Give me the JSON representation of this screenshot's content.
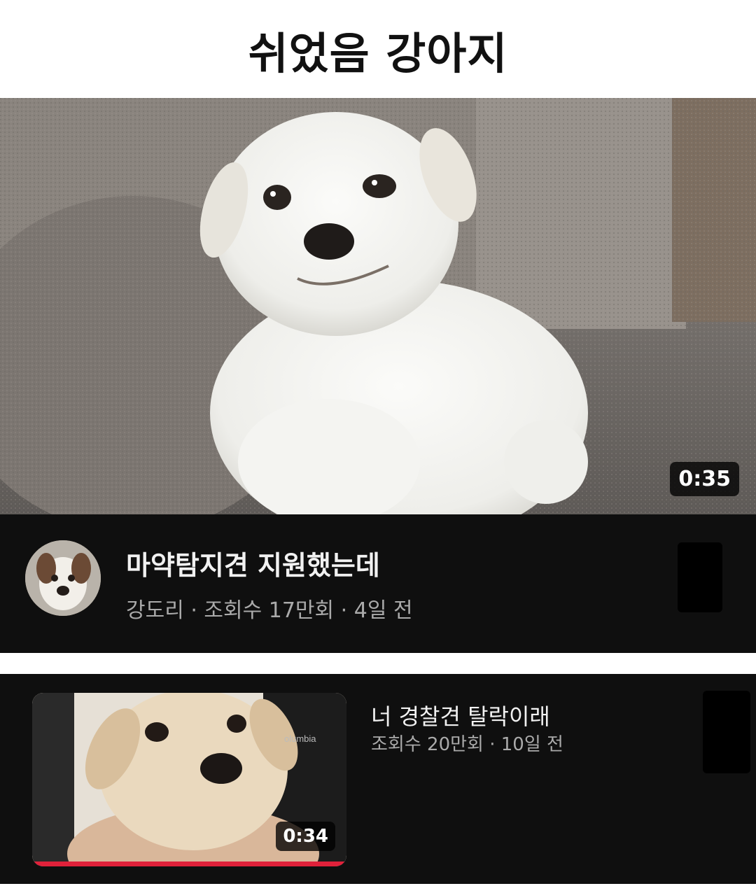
{
  "page_title": "쉬었음 강아지",
  "main_video": {
    "duration": "0:35",
    "title": "마약탐지견 지원했는데",
    "meta": "강도리 · 조회수 17만회 · 4일 전"
  },
  "second_video": {
    "duration": "0:34",
    "title": "너 경찰견 탈락이래",
    "meta": "조회수 20만회 · 10일 전",
    "watched_fraction": 1.0
  },
  "colors": {
    "card_bg": "#0f0f0f",
    "title_text": "#f1f1f1",
    "meta_text": "#aaaaaa",
    "progress": "#e0213a"
  }
}
